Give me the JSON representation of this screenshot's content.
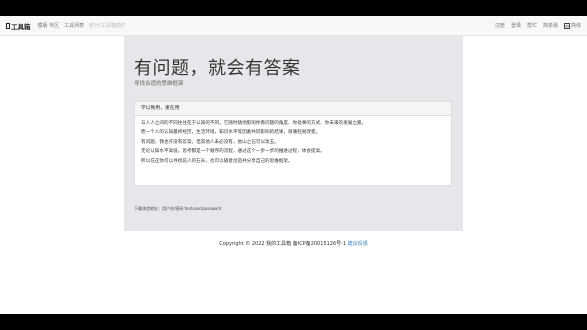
{
  "nav": {
    "brand": "工具箱",
    "left_items": [
      "模版 专区",
      "工具列表"
    ],
    "left_muted": "积分/工具箱插件",
    "right_items": [
      "注册",
      "登录",
      "帮忙",
      "简单易"
    ],
    "lang_label": "中",
    "lang_text": "简体"
  },
  "hero": {
    "title": "有问题，就会有答案",
    "subtitle": "寻找合适的思维框架"
  },
  "panel": {
    "heading": "学以致用，重在用",
    "paragraphs": [
      "与人人之间的不同往往在于认知的不同，它随时随地影响你看问题的角度、你处事的方式、你未来的发展之路。",
      "而一个人的认知最终经历，生活环境，知识水平等因素共同影响的结果，很难轻易改变。",
      "有问题，我也许没有答案，但其他人未必没有，他山之石可以攻玉。",
      "无论认知水平高低，思考都是一个顺序的流程，通过这个一步一步的推进过程，体会提高。",
      "所以在这你可以寻找前人的石头，也可以随意创造并分享自己的思维框架。"
    ]
  },
  "tip": "下载体验地址：用户名/密码 testuser/password",
  "footer": {
    "copyright": "Copyright © 2022 我的工具箱 备ICP备20015126号-1",
    "feedback": "建议反馈"
  }
}
